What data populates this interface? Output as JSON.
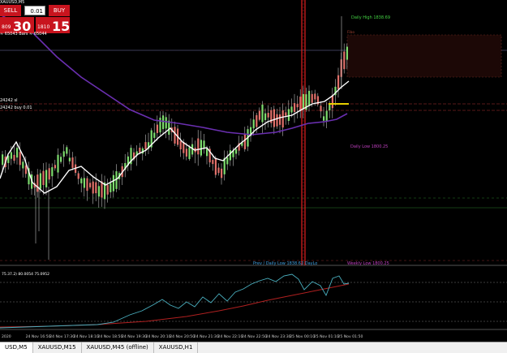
{
  "window": {
    "symbol_title": "XAUUSD,M5"
  },
  "trade_panel": {
    "sell_label": "SELL",
    "buy_label": "BUY",
    "lot_value": "0.01",
    "bid_small": "809",
    "bid_big": "30",
    "ask_small": "1810",
    "ask_big": "15",
    "info": "≈ 65043 Bars ≈ 65044"
  },
  "annotations": {
    "daily_high": "Daily High 1838.69",
    "daily_low": "Daily Low 1800.25",
    "weekly_low": "Weekly Low 1800.25",
    "prev_daily_low": "Prev / Daily Low 1838.62  DayLo",
    "fibo": "Fibo",
    "level_a": "24242 sl",
    "level_b": "24242 buy 0.01",
    "oscillator_header": "75.37.2) 80.0054 75.0952"
  },
  "time_axis": [
    "2020",
    "24 Nov 16:50",
    "24 Nov 17:30",
    "24 Nov 18:10",
    "24 Nov 18:50",
    "24 Nov 19:30",
    "24 Nov 20:10",
    "24 Nov 20:50",
    "24 Nov 21:30",
    "24 Nov 22:10",
    "24 Nov 22:50",
    "24 Nov 23:30",
    "25 Nov 00:10",
    "25 Nov 01:10",
    "25 Nov 01:50"
  ],
  "tabs": [
    {
      "label": "USD,M5",
      "active": true
    },
    {
      "label": "XAUUSD,M15",
      "active": false
    },
    {
      "label": "XAUUSD,M45 (offline)",
      "active": false
    },
    {
      "label": "XAUUSD,H1",
      "active": false
    }
  ],
  "colors": {
    "bull": "#7ddc6e",
    "bear": "#e0706a",
    "ma_white": "#ffffff",
    "ma_purple": "#6a2fb0",
    "vline": "#e02020",
    "daily_high": "#44d444",
    "daily_low": "#c040c0",
    "yellow": "#e8d000"
  }
}
